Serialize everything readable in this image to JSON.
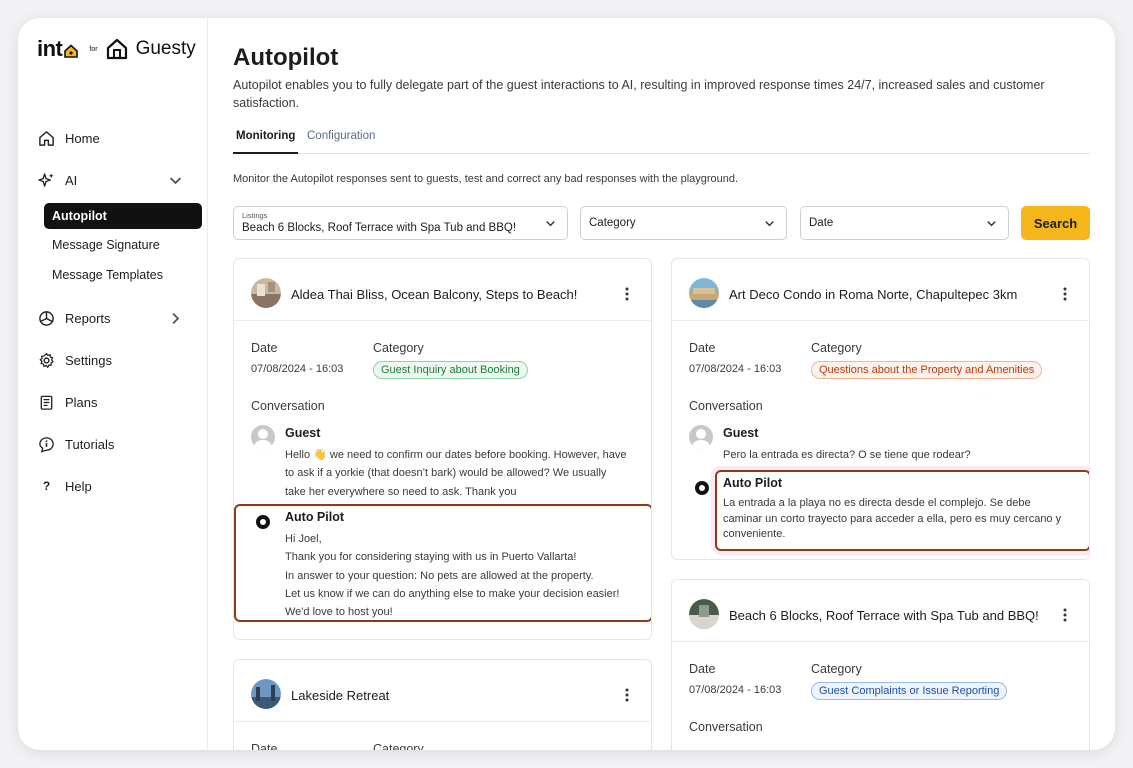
{
  "brand": {
    "into": "int",
    "for": "for",
    "guesty": "Guesty"
  },
  "sidebar": {
    "home": "Home",
    "ai": "AI",
    "sub": {
      "autopilot": "Autopilot",
      "signature": "Message Signature",
      "templates": "Message Templates"
    },
    "reports": "Reports",
    "settings": "Settings",
    "plans": "Plans",
    "tutorials": "Tutorials",
    "help": "Help"
  },
  "page": {
    "title": "Autopilot",
    "description": "Autopilot enables you to fully delegate part of the guest interactions to AI, resulting in improved response times 24/7, increased sales and customer satisfaction.",
    "tabs": [
      "Monitoring",
      "Configuration"
    ],
    "monitor_desc": "Monitor the Autopilot responses sent to guests, test and correct any bad responses with the playground."
  },
  "filters": {
    "listings_label": "Listings",
    "listings_value": "Beach 6 Blocks, Roof Terrace with Spa Tub and BBQ!",
    "category": "Category",
    "date": "Date",
    "search": "Search"
  },
  "labels": {
    "date": "Date",
    "category": "Category",
    "conversation": "Conversation",
    "guest": "Guest",
    "autopilot": "Auto Pilot"
  },
  "cards": [
    {
      "title": "Aldea Thai Bliss, Ocean Balcony, Steps to Beach!",
      "date": "07/08/2024 - 16:03",
      "category": "Guest Inquiry about Booking",
      "guest_lines": [
        "Hello 👋 we need to confirm our dates before booking. However, have",
        "to ask if a yorkie (that doesn’t bark) would be allowed? We usually",
        "take her everywhere so need to ask. Thank you"
      ],
      "ap_lines": [
        "Hi Joel,",
        "Thank you for considering staying with us in Puerto Vallarta!",
        "In answer to your question: No pets are allowed at the property.",
        "Let us know if we can do anything else to make your decision easier!",
        "We'd love to host you!"
      ]
    },
    {
      "title": "Art Deco Condo in Roma Norte, Chapultepec 3km",
      "date": "07/08/2024 - 16:03",
      "category": "Questions about the Property and Amenities",
      "guest_lines": [
        "Pero la entrada es directa? O se tiene que rodear?"
      ],
      "ap_lines": [
        "La entrada a la playa no es directa desde el complejo. Se debe",
        "caminar un corto trayecto para acceder a ella, pero es muy cercano y",
        "conveniente."
      ]
    },
    {
      "title": "Lakeside Retreat"
    },
    {
      "title": "Beach 6 Blocks, Roof Terrace with Spa Tub and BBQ!",
      "date": "07/08/2024 - 16:03",
      "category": "Guest Complaints or Issue Reporting"
    }
  ]
}
